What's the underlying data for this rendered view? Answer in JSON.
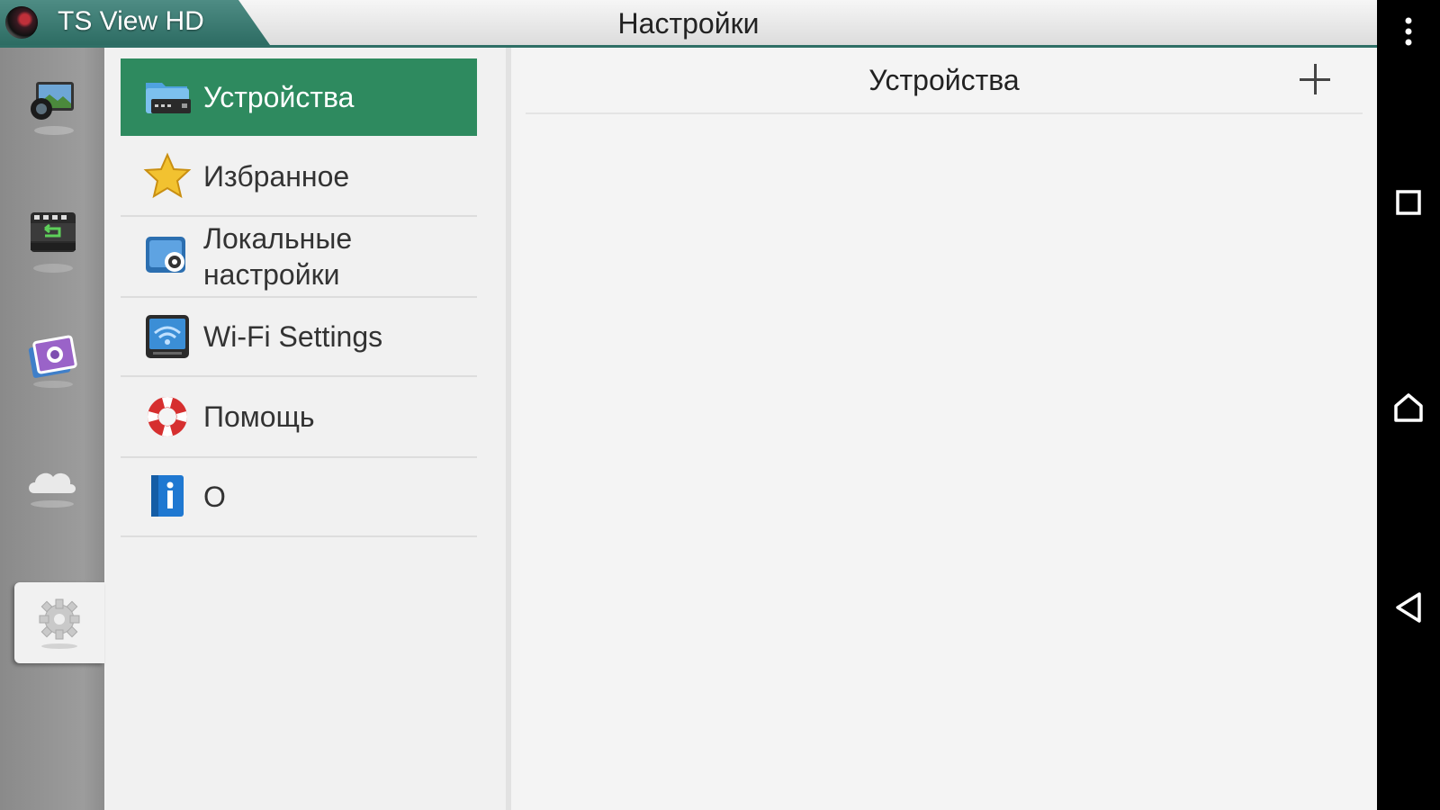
{
  "app": {
    "name": "TS View HD"
  },
  "header": {
    "title": "Настройки"
  },
  "rail": {
    "items": [
      {
        "icon": "live-view-icon"
      },
      {
        "icon": "playback-icon"
      },
      {
        "icon": "photos-icon"
      },
      {
        "icon": "cloud-icon"
      },
      {
        "icon": "settings-icon",
        "active": true
      }
    ]
  },
  "menu": {
    "items": [
      {
        "label": "Устройства",
        "icon": "devices-folder-icon",
        "selected": true
      },
      {
        "label": "Избранное",
        "icon": "star-icon"
      },
      {
        "label": "Локальные настройки",
        "icon": "local-settings-icon"
      },
      {
        "label": "Wi-Fi Settings",
        "icon": "wifi-settings-icon"
      },
      {
        "label": "Помощь",
        "icon": "lifebuoy-icon"
      },
      {
        "label": "О",
        "icon": "info-icon"
      }
    ]
  },
  "content": {
    "title": "Устройства",
    "add_icon": "plus-icon"
  },
  "system_nav": {
    "menu_icon": "overflow-menu-icon",
    "recent_icon": "recent-apps-icon",
    "home_icon": "home-icon",
    "back_icon": "back-icon"
  },
  "colors": {
    "accent": "#2e8a5f",
    "brand": "#3a7a72"
  }
}
